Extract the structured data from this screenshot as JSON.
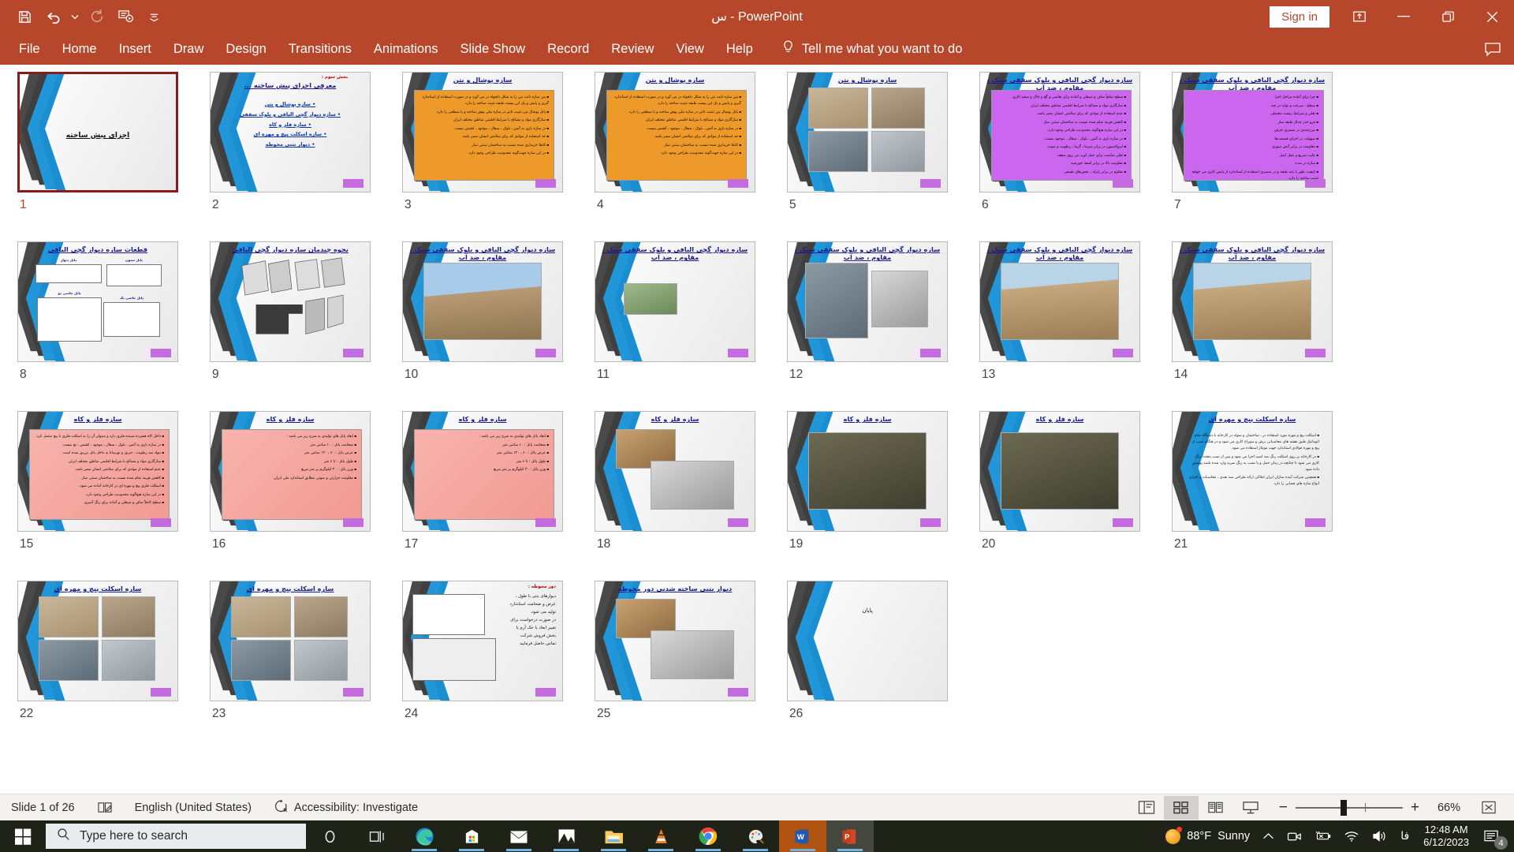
{
  "titlebar": {
    "title": "س  -  PowerPoint",
    "signin_label": "Sign in",
    "qat": [
      {
        "name": "save-icon",
        "label": "Save"
      },
      {
        "name": "undo-icon",
        "label": "Undo"
      },
      {
        "name": "undo-dropdown-icon",
        "label": "Undo options"
      },
      {
        "name": "redo-icon",
        "label": "Redo"
      },
      {
        "name": "start-presentation-icon",
        "label": "Start From Beginning"
      },
      {
        "name": "customize-quick-access-toolbar-icon",
        "label": "Customize Quick Access Toolbar"
      }
    ],
    "window_buttons": [
      {
        "name": "restore-down-ribbon-icon",
        "label": "Ribbon Display Options"
      },
      {
        "name": "minimize-icon",
        "label": "Minimize"
      },
      {
        "name": "restore-icon",
        "label": "Restore Down"
      },
      {
        "name": "close-icon",
        "label": "Close"
      }
    ]
  },
  "ribbon": {
    "tabs": [
      "File",
      "Home",
      "Insert",
      "Draw",
      "Design",
      "Transitions",
      "Animations",
      "Slide Show",
      "Record",
      "Review",
      "View",
      "Help"
    ],
    "tellme": "Tell me what you want to do"
  },
  "slides": [
    {
      "number": "1",
      "selected": true,
      "layout": "title",
      "title": "اجزای پیش ساخته"
    },
    {
      "number": "2",
      "layout": "agenda",
      "kicker": "بخش سوم :",
      "title": "معرفی اجزای پیش ساخته ...",
      "bullets": [
        "• سازه پوشال و بتن",
        "• سازه دیوار گچی الیافی و بلوک سقفی",
        "• سازه فلز و کاه",
        "• سازه اسکلت پیچ و مهره ای",
        "• دیوار بتنی محوطه"
      ]
    },
    {
      "number": "3",
      "layout": "content-box",
      "box_color": "orange",
      "title": "سازه پوشال و بتن",
      "body": [
        "پتن سازه ثابت بتن را به شکل دلخواه در می آورد و در صورت استفاده از استاندارد گیری و پایش و یک این پیست طبقه تثبیت ساخته را دارد.",
        "پانل پوشال پتن تثبیت تاثیر در سازه ملی پوش ساخته و یا سطحی را دارد.",
        "سازگاری مواد و مصالح با شرایط اقلیمی مناطق مختلف ایران",
        "در سازه بازی به آتش ، بلوک ، سقال ، موجود ، کشش نیست.",
        "حد استفاده از موادی که برای سلامتی انسان مضر باشد.",
        "کاملا خریداری شده نسبت به ساختمان سنتی ساز",
        "در این سازه جهت‌گونه محدودیت طراحی وجود دارد."
      ]
    },
    {
      "number": "4",
      "layout": "content-box",
      "box_color": "orange",
      "title": "سازه پوشال و بتن",
      "body": [
        "پتن سازه ثابت بتن را به شکل دلخواه در می آورد و در صورت استفاده از استاندارد گیری و پایش و یک این پیست طبقه تثبیت ساخته را دارد.",
        "پانل پوشال پتن تثبیت تاثیر در سازه ملی پوش ساخته و یا سطحی را دارد.",
        "سازگاری مواد و مصالح با شرایط اقلیمی مناطق مختلف ایران",
        "در سازه بازی به آتش ، بلوک ، سقال ، موجود ، کشش نیست.",
        "حد استفاده از موادی که برای سلامتی انسان مضر باشد.",
        "کاملا خریداری شده نسبت به ساختمان سنتی ساز",
        "در این سازه جهت‌گونه محدودیت طراحی وجود دارد."
      ]
    },
    {
      "number": "5",
      "layout": "photos-4",
      "title": "سازه پوشال و بتن"
    },
    {
      "number": "6",
      "layout": "content-box",
      "box_color": "purple",
      "title": "سازه دیوار گچی الیافی و بلوک سقفی سبک ، مقاوم ، ضد آب",
      "body": [
        "سطح تمام‌اً صاف و صیقلی و آماده برای نقاشی و گچ و خاک و سفید کاری",
        "سازگاری مواد و مصالح با شرایط اقلیمی مناطق مختلف ایران",
        "عدم استفاده از موادی که برای سلامتی انسان مضر باشد.",
        "کاهش هزینه تمام شده نسبت به ساختمان سنتی ساز",
        "در این سازه هیچ‌گونه محدودیت طراحی وجود دارد.",
        "در سازه بازی به آتش ، بلوک ، سقال ، موجود نیست.",
        "ایزولاسیون در برابر سرما ، گرما ، رطوبت و صوت",
        "ثقلی مناسب برای حمل آورد بتن روی سقف",
        "مقاومت بالا در برابر اشعه خورشید",
        "مقاوم در برابر زلزله ، بخش‌های طبیعی"
      ]
    },
    {
      "number": "7",
      "layout": "content-box",
      "box_color": "purple",
      "title": "سازه دیوار گچی الیافی و بلوک سقفی سبک ، مقاوم ، ضد آب",
      "body": [
        "چرا برای آماده مراحل اجرا",
        "سطح ، سرعت و تولید در چند",
        "ثقلی و شرایط زیست محیطی",
        "فرو خدر جدال طبقه ساز",
        "مرزه‌بندی در ضمیری خزش",
        "سهولت در اجرای قسمت‌ها",
        "مقاومت در برابر آتش سوزی",
        "عایب سریع و عمل اصل",
        "سازه در مدت",
        "کیفیت طور با پایه طبقه و در ضمیری استفاده از استاندارد از پایش کاری می خواهد تثبیت ساخته را دارد."
      ]
    },
    {
      "number": "8",
      "layout": "diagram-4",
      "title": "قطعات سازه دیوار گچی الیافی",
      "labels": [
        "پانل دیوار",
        "پانل ستون",
        "پانل حاسی دو",
        "پانل حاسی تک"
      ]
    },
    {
      "number": "9",
      "layout": "panels-3d",
      "title": "نحوه چیدمان سازه دیوار گچی الیافی"
    },
    {
      "number": "10",
      "layout": "photo-1",
      "photo_class": "sky",
      "title": "سازه دیوار گچی الیافی و بلوک سقفی سبک ، مقاوم ، ضد آب"
    },
    {
      "number": "11",
      "layout": "photo-small",
      "photo_class": "green",
      "title": "سازه دیوار گچی الیافی و بلوک سقفی سبک ، مقاوم ، ضد آب"
    },
    {
      "number": "12",
      "layout": "photo-2",
      "title": "سازه دیوار گچی الیافی و بلوک سقفی سبک ، مقاوم ، ضد آب"
    },
    {
      "number": "13",
      "layout": "photo-1",
      "photo_class": "field",
      "title": "سازه دیوار گچی الیافی و بلوک سقفی سبک ، مقاوم ، ضد آب"
    },
    {
      "number": "14",
      "layout": "photo-1",
      "photo_class": "field",
      "title": "سازه دیوار گچی الیافی و بلوک سقفی سبک ، مقاوم ، ضد آب"
    },
    {
      "number": "15",
      "layout": "content-box",
      "box_color": "pink",
      "title": "سازه فلز و کاه",
      "body": [
        "داخل کاه فشرده شینده فلزی دارد و میتوان آن را به اسکلت فلزی با پیچ متصل کرد.",
        "در سازه بازی به آتش ، بلوک ، سقال ، موجود ، کشش ، نچ نیست.",
        "مواد ضد رطوبت ، حریق و نورسانا به داخل پانل تزریق شده است.",
        "سازگاری مواد و مصالح با شرایط اقلیمی مناطق مختلف ایران",
        "عدم استفاده از موادی که برای سلامتی انسان مضر باشد.",
        "کاهش هزینه تمام شده نسبت به ساختمان سنتی ساز",
        "اسکلت فلزی پیچ و مهره ای در کارخانه آماده می شود.",
        "در این سازه هیچ‌گونه محدودیت طراحی وجود دارد.",
        "سطح کاملاً صاف و صیقلی و آماده برای رنگ آمیزی"
      ]
    },
    {
      "number": "16",
      "layout": "content-box",
      "box_color": "pink",
      "title": "سازه فلز و کاه",
      "body": [
        "ابعاد پانل های تولیدی به شرح زیر می باشد :",
        "ضخامت پانل : ۱۰ سانتی متر",
        "عرض پانل : ۶۰ ، ۱۲۰ سانتی متر",
        "طول پانل : تا ۶ متر",
        "وزن پانل : ۳۰ کیلوگرم بر متر مربع",
        "مقاومت حرارتی و صوتی مطابق استاندارد ملی ایران"
      ]
    },
    {
      "number": "17",
      "layout": "content-box",
      "box_color": "pink",
      "title": "سازه فلز و کاه",
      "body": [
        "ابعاد پانل های تولیدی به شرح زیر می باشد :",
        "ضخامت پانل : ۱۰ سانتی متر",
        "عرض پانل : ۶۰ ، ۱۲۰ سانتی متر",
        "طول پانل : تا ۶ متر",
        "وزن پانل : ۳۰ کیلوگرم بر متر مربع"
      ]
    },
    {
      "number": "18",
      "layout": "photo-2v",
      "title": "سازه فلز و کاه"
    },
    {
      "number": "19",
      "layout": "photo-1",
      "photo_class": "forest",
      "title": "سازه فلز و کاه"
    },
    {
      "number": "20",
      "layout": "photo-1",
      "photo_class": "forest",
      "title": "سازه فلز و کاه"
    },
    {
      "number": "21",
      "layout": "content-box",
      "box_color": "plain",
      "title": "سازه اسکلت پیچ و مهره ای",
      "body": [
        "اسکلت پیچ و مهره مورد استفاده در ، ساختمان و سوله در کارخانه با دستگاه تمام اتوماتیک طبق نقشه های محاسباتی برش و سوراخ کاری می شود و در هنگام نصب از پیچ و مهره فولادی استاندارد جهت مونتاژ استفاده می شود.",
        "در کارخانه بر روی اسکلت رنگ ضد اسید اجرا می شود و پس از نصب مجدداً رنگ کاری می شود تا چنانچه در زمان حمل و یا نصب به رنگ ضربه وارد شده باشد پوشش داده شود.",
        "همچنین شرکت آینده سازان ایران املاکی ارائه طراحی سه بعدی ، محاسبات و اجرای انواع سازه های فضایی را دارد."
      ]
    },
    {
      "number": "22",
      "layout": "photos-4",
      "title": "سازه اسکلت پیچ و مهره ای"
    },
    {
      "number": "23",
      "layout": "photos-4",
      "title": "سازه اسکلت پیچ و مهره ای"
    },
    {
      "number": "24",
      "layout": "wall-text",
      "title": "دور محوطه :",
      "body": [
        "دیوارهای بتنی با طول ،",
        "عرض و ضخامت استاندارد",
        "تولید می شود.",
        "در صورت درخواست برای",
        "تغییر ابعاد با حک آرم با",
        "بخش فروش شرکت",
        "تماس حاصل فرمایید"
      ]
    },
    {
      "number": "25",
      "layout": "photo-2v",
      "title": "دیوار بتنی ساخته شدنی دور محوطه"
    },
    {
      "number": "26",
      "layout": "end",
      "title": "پایان"
    }
  ],
  "statusbar": {
    "slide_indicator": "Slide 1 of 26",
    "notes_icon": "notes-icon",
    "language": "English (United States)",
    "accessibility": "Accessibility: Investigate",
    "views": [
      {
        "name": "normal-view-button",
        "label": "Normal"
      },
      {
        "name": "slide-sorter-view-button",
        "label": "Slide Sorter",
        "active": true
      },
      {
        "name": "reading-view-button",
        "label": "Reading View"
      },
      {
        "name": "slide-show-button",
        "label": "Slide Show"
      }
    ],
    "zoom_out": "−",
    "zoom_in": "+",
    "zoom_level": "66%",
    "fit_label": "Fit slide to current window"
  },
  "taskbar": {
    "start_label": "Start",
    "search_placeholder": "Type here to search",
    "apps": [
      {
        "name": "cortana-icon",
        "label": "Cortana"
      },
      {
        "name": "task-view-icon",
        "label": "Task View"
      },
      {
        "name": "microsoft-edge-icon",
        "label": "Microsoft Edge",
        "running": true
      },
      {
        "name": "microsoft-store-icon",
        "label": "Microsoft Store",
        "running": true
      },
      {
        "name": "mail-icon",
        "label": "Mail",
        "running": true
      },
      {
        "name": "photos-icon",
        "label": "Photos",
        "running": true
      },
      {
        "name": "file-explorer-icon",
        "label": "File Explorer",
        "running": true
      },
      {
        "name": "vlc-media-player-icon",
        "label": "VLC media player",
        "running": true
      },
      {
        "name": "google-chrome-icon",
        "label": "Google Chrome",
        "running": true
      },
      {
        "name": "paint-icon",
        "label": "Paint",
        "running": true
      },
      {
        "name": "microsoft-word-icon",
        "label": "Word",
        "running": true,
        "active": true
      },
      {
        "name": "microsoft-powerpoint-icon",
        "label": "PowerPoint",
        "running": true,
        "active": true
      }
    ],
    "tray": {
      "weather_temp": "88°F",
      "weather_desc": "Sunny",
      "chevron": "⌃",
      "time": "12:48 AM",
      "date": "6/12/2023",
      "notification_count": "4"
    }
  }
}
